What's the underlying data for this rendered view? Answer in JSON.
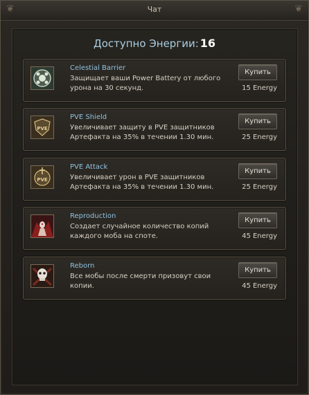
{
  "window": {
    "title": "Чат"
  },
  "energy": {
    "label": "Доступно Энергии:",
    "value": "16"
  },
  "items": [
    {
      "name": "Celestial Barrier",
      "desc": "Защищает ваши Power Battery от любого урона на 30 секунд.",
      "buy": "Купить",
      "cost": "15 Energy",
      "icon": "celestial-barrier-icon"
    },
    {
      "name": "PVE Shield",
      "desc": "Увеличивает защиту в PVE защитников Артефакта на 35% в течении 1.30 мин.",
      "buy": "Купить",
      "cost": "25 Energy",
      "icon": "pve-shield-icon"
    },
    {
      "name": "PVE Attack",
      "desc": "Увеличивает урон в PVE защитников Артефакта на 35% в течении 1.30 мин.",
      "buy": "Купить",
      "cost": "25 Energy",
      "icon": "pve-attack-icon"
    },
    {
      "name": "Reproduction",
      "desc": "Создает случайное количество копий каждого моба на споте.",
      "buy": "Купить",
      "cost": "45 Energy",
      "icon": "reproduction-icon"
    },
    {
      "name": "Reborn",
      "desc": "Все мобы после смерти призовут свои копии.",
      "buy": "Купить",
      "cost": "45 Energy",
      "icon": "reborn-icon"
    }
  ],
  "colors": {
    "accent_blue": "#8fc2e0",
    "text": "#d6d0c4",
    "frame": "#5c5445"
  }
}
